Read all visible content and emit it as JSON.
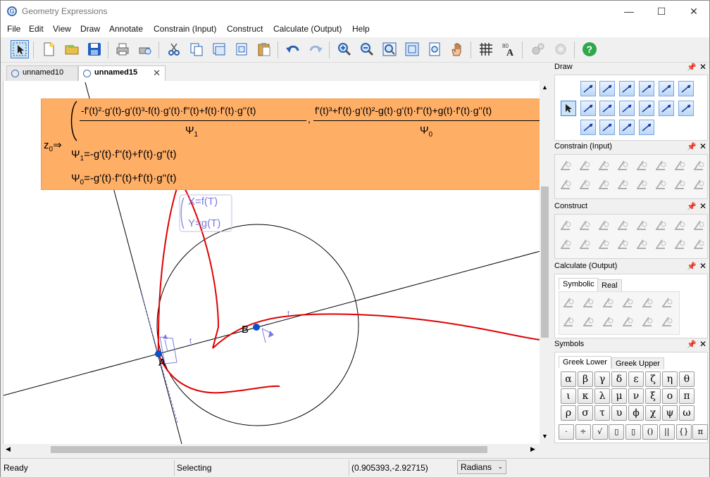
{
  "window": {
    "title": "Geometry Expressions",
    "minimize": "—",
    "maximize": "☐",
    "close": "✕"
  },
  "menu": [
    "File",
    "Edit",
    "View",
    "Draw",
    "Annotate",
    "Constrain (Input)",
    "Construct",
    "Calculate (Output)",
    "Help"
  ],
  "tabs": [
    {
      "label": "unnamed10",
      "active": false
    },
    {
      "label": "unnamed15",
      "active": true,
      "close": "✕"
    }
  ],
  "canvas": {
    "z0": "z",
    "z0_sub": "0",
    "z0_arrow": "⇒",
    "frac1_num": "-f'(t)²·g'(t)-g'(t)³-f(t)·g'(t)·f''(t)+f(t)·f'(t)·g''(t)",
    "frac1_den": "Ψ",
    "frac1_den_sub": "1",
    "comma": ",",
    "frac2_num": "f'(t)³+f'(t)·g'(t)²-g(t)·g'(t)·f''(t)+g(t)·f'(t)·g''(t)",
    "frac2_den": "Ψ",
    "frac2_den_sub": "0",
    "psi1_lhs": "Ψ",
    "psi1_sub": "1",
    "psi1_rhs": "=-g'(t)·f''(t)+f'(t)·g''(t)",
    "psi0_lhs": "Ψ",
    "psi0_sub": "0",
    "psi0_rhs": "=-g'(t)·f''(t)+f'(t)·g''(t)",
    "param_x": "X=f(T)",
    "param_y": "Y=g(T)",
    "point_a": "A",
    "point_b": "B",
    "tick": "t"
  },
  "status": {
    "left": "Ready",
    "mode": "Selecting",
    "coords": "(0.905393,-2.92715)",
    "units": "Radians"
  },
  "panels": {
    "draw": {
      "title": "Draw"
    },
    "constrain": {
      "title": "Constrain (Input)"
    },
    "construct": {
      "title": "Construct"
    },
    "calculate": {
      "title": "Calculate (Output)",
      "tab_symbolic": "Symbolic",
      "tab_real": "Real"
    },
    "symbols": {
      "title": "Symbols",
      "tab_lower": "Greek Lower",
      "tab_upper": "Greek Upper",
      "greek": [
        "α",
        "β",
        "γ",
        "δ",
        "ε",
        "ζ",
        "η",
        "θ",
        "ι",
        "κ",
        "λ",
        "μ",
        "ν",
        "ξ",
        "ο",
        "π",
        "ρ",
        "σ",
        "τ",
        "υ",
        "ϕ",
        "χ",
        "ψ",
        "ω"
      ],
      "ops": [
        "·",
        "÷",
        "√",
        "▯",
        "▯",
        "()",
        "||",
        "{}",
        "π"
      ]
    }
  },
  "colors": {
    "accent": "#0b50c8",
    "curve": "#e00000",
    "highlight": "#ffae66",
    "helper": "#7a7ae0"
  }
}
